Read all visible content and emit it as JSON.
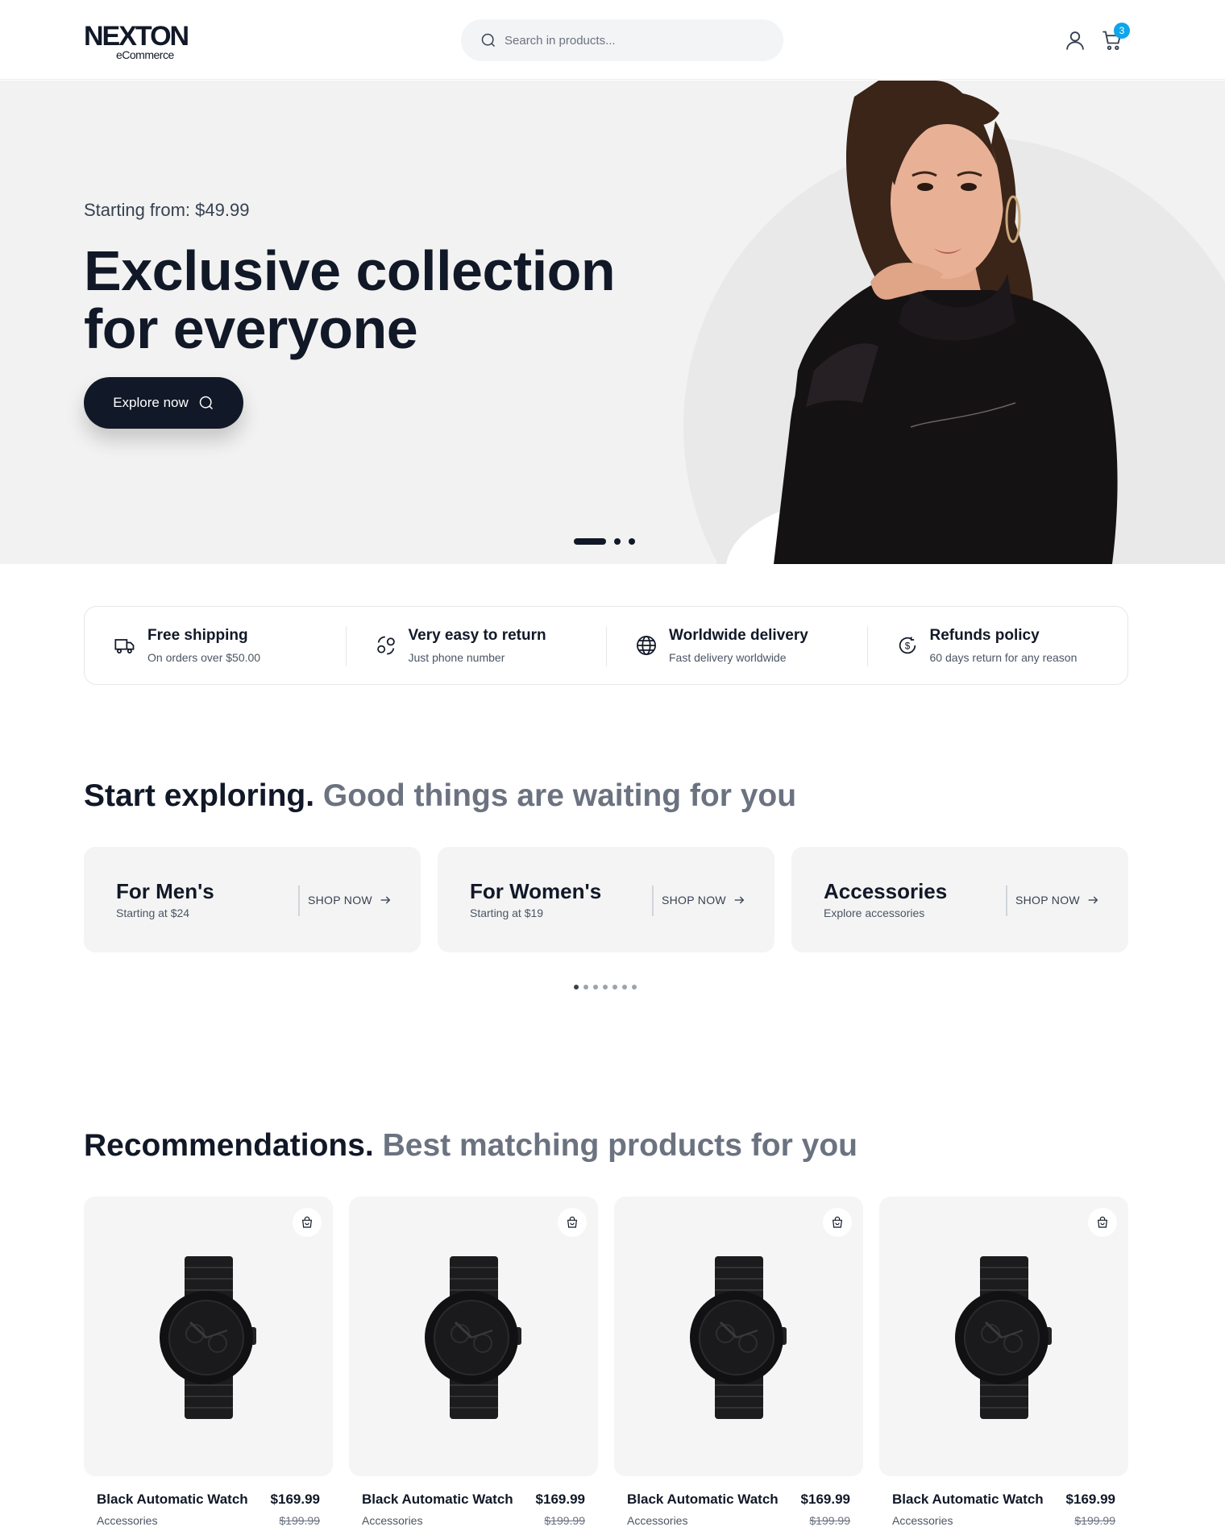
{
  "header": {
    "logo_main": "NEXTON",
    "logo_sub": "eCommerce",
    "search_placeholder": "Search in products...",
    "cart_count": "3"
  },
  "hero": {
    "subtitle": "Starting from: $49.99",
    "title": "Exclusive collection for everyone",
    "button_label": "Explore now",
    "slide_count": 3,
    "active_slide": 1
  },
  "features": [
    {
      "icon": "delivery-truck-icon",
      "title": "Free shipping",
      "subtitle": "On orders over $50.00"
    },
    {
      "icon": "return-exchange-icon",
      "title": "Very easy to return",
      "subtitle": "Just phone number"
    },
    {
      "icon": "globe-icon",
      "title": "Worldwide delivery",
      "subtitle": "Fast delivery worldwide"
    },
    {
      "icon": "refund-dollar-icon",
      "title": "Refunds policy",
      "subtitle": "60 days return for any reason"
    }
  ],
  "explore": {
    "heading_bold": "Start exploring.",
    "heading_muted": "Good things are waiting for you",
    "categories": [
      {
        "title": "For Men's",
        "subtitle": "Starting at $24",
        "link": "SHOP NOW"
      },
      {
        "title": "For Women's",
        "subtitle": "Starting at $19",
        "link": "SHOP NOW"
      },
      {
        "title": "Accessories",
        "subtitle": "Explore accessories",
        "link": "SHOP NOW"
      }
    ],
    "pager_count": 7,
    "pager_active": 1
  },
  "recommendations": {
    "heading_bold": "Recommendations.",
    "heading_muted": "Best matching products for you",
    "products": [
      {
        "name": "Black Automatic Watch",
        "category": "Accessories",
        "price": "$169.99",
        "old_price": "$199.99"
      },
      {
        "name": "Black Automatic Watch",
        "category": "Accessories",
        "price": "$169.99",
        "old_price": "$199.99"
      },
      {
        "name": "Black Automatic Watch",
        "category": "Accessories",
        "price": "$169.99",
        "old_price": "$199.99"
      },
      {
        "name": "Black Automatic Watch",
        "category": "Accessories",
        "price": "$169.99",
        "old_price": "$199.99"
      }
    ]
  },
  "colors": {
    "primary_dark": "#111827",
    "badge_blue": "#0ea5e9",
    "hero_bg": "#f2f2f2",
    "muted_text": "#6b7280"
  }
}
